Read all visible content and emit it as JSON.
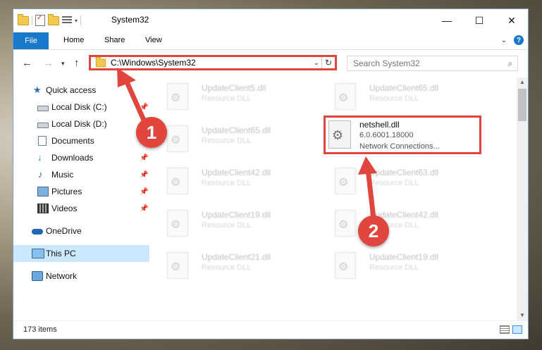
{
  "window": {
    "title": "System32",
    "controls": {
      "minimize": "—",
      "maximize": "☐",
      "close": "✕"
    }
  },
  "ribbon": {
    "tabs": [
      "File",
      "Home",
      "Share",
      "View"
    ]
  },
  "address": {
    "path": "C:\\Windows\\System32",
    "search_placeholder": "Search System32"
  },
  "sidebar": {
    "items": [
      {
        "label": "Quick access",
        "icon": "star-icon",
        "pinned": false
      },
      {
        "label": "Local Disk (C:)",
        "icon": "disk-icon",
        "pinned": true
      },
      {
        "label": "Local Disk (D:)",
        "icon": "disk-icon",
        "pinned": true
      },
      {
        "label": "Documents",
        "icon": "documents-icon",
        "pinned": true
      },
      {
        "label": "Downloads",
        "icon": "downloads-icon",
        "pinned": true
      },
      {
        "label": "Music",
        "icon": "music-icon",
        "pinned": true
      },
      {
        "label": "Pictures",
        "icon": "pictures-icon",
        "pinned": true
      },
      {
        "label": "Videos",
        "icon": "videos-icon",
        "pinned": true
      },
      {
        "label": "OneDrive",
        "icon": "onedrive-icon",
        "pinned": false
      },
      {
        "label": "This PC",
        "icon": "this-pc-icon",
        "pinned": false,
        "selected": true
      },
      {
        "label": "Network",
        "icon": "network-icon",
        "pinned": false
      }
    ]
  },
  "files": {
    "left": [
      {
        "name": "UpdateClient5.dll",
        "desc": "Resource DLL"
      },
      {
        "name": "UpdateClient65.dll",
        "desc": "Resource DLL"
      },
      {
        "name": "UpdateClient42.dll",
        "desc": "Resource DLL"
      },
      {
        "name": "UpdateClient19.dll",
        "desc": "Resource DLL"
      },
      {
        "name": "UpdateClient21.dll",
        "desc": "Resource DLL"
      }
    ],
    "right": [
      {
        "name": "UpdateClient65.dll",
        "desc": "Resource DLL"
      },
      {
        "name": "UpdateClient63.dll",
        "desc": "Resource DLL"
      },
      {
        "name": "UpdateClient42.dll",
        "desc": "Resource DLL"
      },
      {
        "name": "UpdateClient19.dll",
        "desc": "Resource DLL"
      }
    ],
    "highlighted": {
      "name": "netshell.dll",
      "version": "6.0.6001.18000",
      "desc": "Network Connections..."
    }
  },
  "status": {
    "count": "173 items"
  },
  "annotations": {
    "marker1": "1",
    "marker2": "2",
    "color": "#e0463d"
  }
}
